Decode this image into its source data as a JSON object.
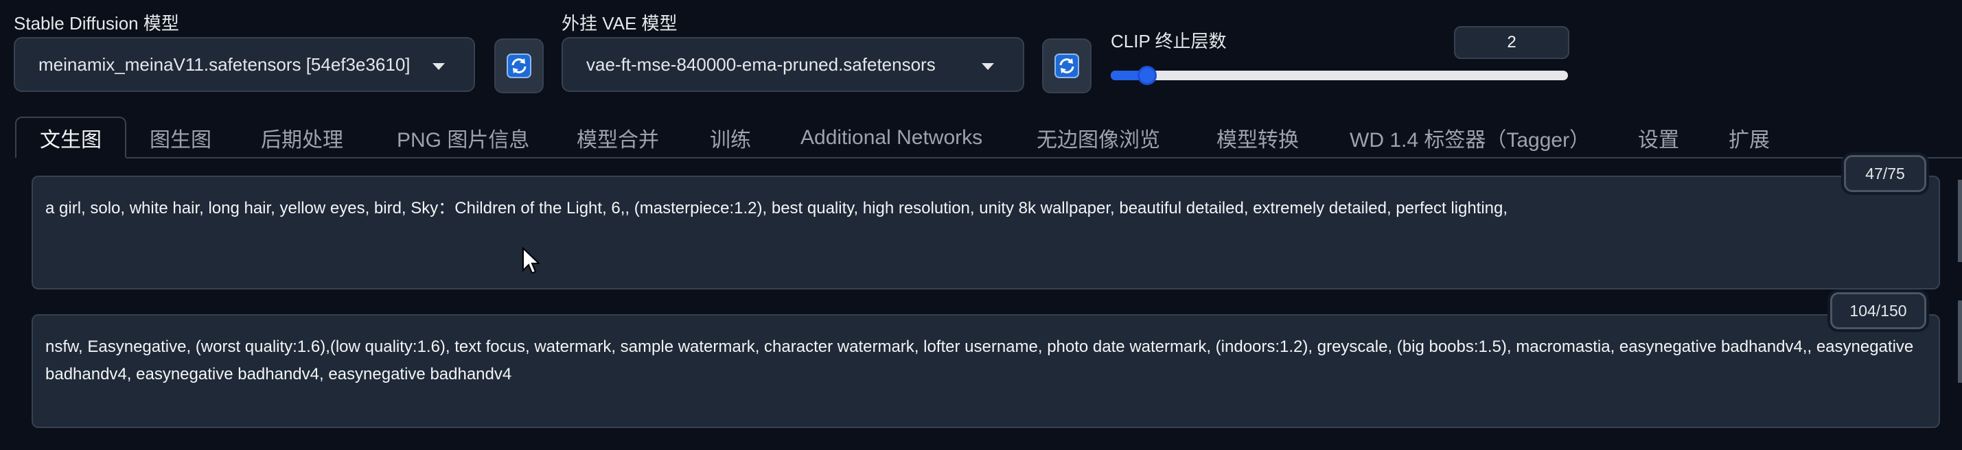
{
  "model_select": {
    "label": "Stable Diffusion 模型",
    "value": "meinamix_meinaV11.safetensors [54ef3e3610]"
  },
  "vae_select": {
    "label": "外挂 VAE 模型",
    "value": "vae-ft-mse-840000-ema-pruned.safetensors"
  },
  "clip_skip": {
    "label": "CLIP 终止层数",
    "value": "2",
    "min": 1,
    "max": 12,
    "level": 0.08
  },
  "tabs": [
    {
      "label": "文生图",
      "active": true
    },
    {
      "label": "图生图"
    },
    {
      "label": "后期处理"
    },
    {
      "label": "PNG 图片信息"
    },
    {
      "label": "模型合并"
    },
    {
      "label": "训练"
    },
    {
      "label": "Additional Networks"
    },
    {
      "label": "无边图像浏览"
    },
    {
      "label": "模型转换"
    },
    {
      "label": "WD 1.4 标签器（Tagger）"
    },
    {
      "label": "设置"
    },
    {
      "label": "扩展"
    }
  ],
  "prompt": {
    "text": "a girl, solo, white hair, long hair, yellow eyes, bird, Sky：Children of the Light, 6,, (masterpiece:1.2), best quality, high resolution, unity 8k wallpaper, beautiful detailed, extremely detailed, perfect lighting,",
    "token_count": "47/75"
  },
  "negative_prompt": {
    "text": "nsfw, Easynegative, (worst quality:1.6),(low quality:1.6), text focus, watermark, sample watermark, character watermark, lofter username, photo date watermark, (indoors:1.2), greyscale, (big boobs:1.5), macromastia, easynegative badhandv4,, easynegative badhandv4, easynegative badhandv4, easynegative badhandv4",
    "token_count": "104/150"
  },
  "icons": {
    "refresh": "refresh-icon",
    "caret": "chevron-down-icon",
    "cursor": "mouse-cursor-icon"
  },
  "colors": {
    "accent": "#2563eb",
    "background": "#0b0f19",
    "panel": "#1f2937"
  }
}
